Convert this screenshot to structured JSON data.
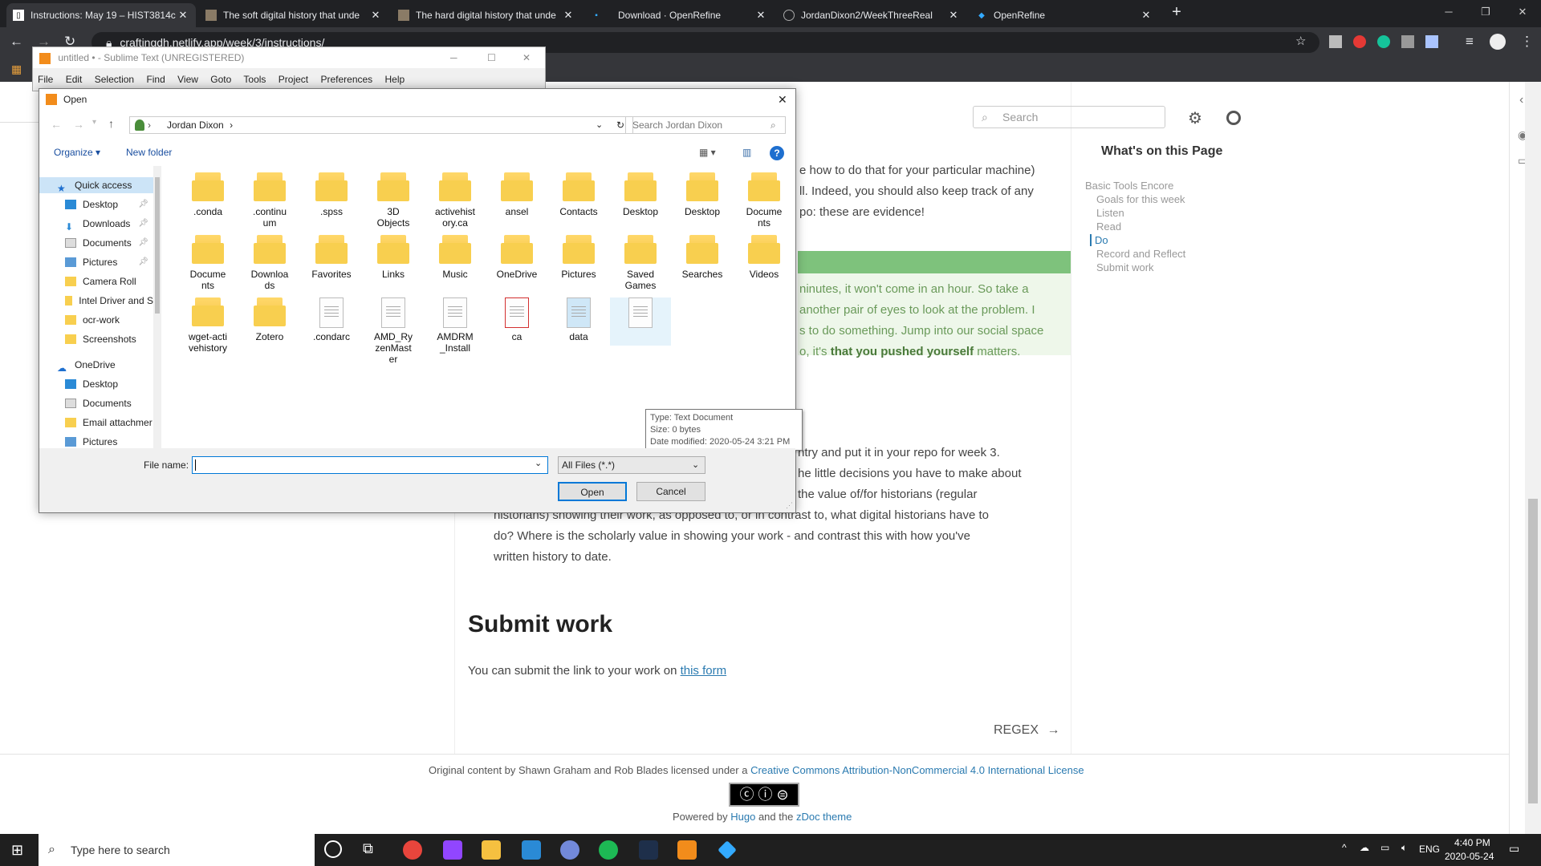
{
  "browser": {
    "tabs": [
      {
        "title": "Instructions: May 19 – HIST3814c"
      },
      {
        "title": "The soft digital history that unde"
      },
      {
        "title": "The hard digital history that unde"
      },
      {
        "title": "Download · OpenRefine"
      },
      {
        "title": "JordanDixon2/WeekThreeReal"
      },
      {
        "title": "OpenRefine"
      }
    ],
    "url": "craftingdh.netlify.app/week/3/instructions/"
  },
  "page": {
    "search_placeholder": "Search",
    "toc_title": "What's on this Page",
    "toc": [
      "Basic Tools Encore",
      "Goals for this week",
      "Listen",
      "Read",
      "Do",
      "Record and Reflect",
      "Submit work"
    ],
    "text_lines": [
      "e how to do that for your particular machine)",
      "ll. Indeed, you should also keep track of any",
      "po: these are evidence!"
    ],
    "notice_lines": [
      "ninutes, it won't come in an hour. So take a",
      "another pair of eyes to look at the problem. I",
      "s to do something. Jump into our social space"
    ],
    "notice_last_prefix": "o, it's ",
    "notice_last_bold": "that you pushed yourself",
    "notice_last_suffix": " matters.",
    "lines2": [
      "ntry and put it in your repo for week 3.",
      "he little decisions you have to make about",
      "the value of/for historians (regular"
    ],
    "lines3": [
      "historians) showing their work, as opposed to, or in contrast to, what digital historians have to",
      "do? Where is the scholarly value in showing your work - and contrast this with how you've",
      "written history to date."
    ],
    "submit_heading": "Submit work",
    "submit_prefix": "You can submit the link to your work on ",
    "submit_link": "this form",
    "next_link": "REGEX",
    "footer_prefix": "Original content by Shawn Graham and Rob Blades licensed under a ",
    "footer_link": "Creative Commons Attribution-NonCommercial 4.0 International License",
    "footer_powered": "Powered by ",
    "footer_hugo": "Hugo",
    "footer_and": " and the ",
    "footer_theme": "zDoc theme"
  },
  "sublime": {
    "title": "untitled • - Sublime Text (UNREGISTERED)",
    "menu": [
      "File",
      "Edit",
      "Selection",
      "Find",
      "View",
      "Goto",
      "Tools",
      "Project",
      "Preferences",
      "Help"
    ]
  },
  "dialog": {
    "title": "Open",
    "path": "Jordan Dixon",
    "search_placeholder": "Search Jordan Dixon",
    "organize": "Organize ▾",
    "new_folder": "New folder",
    "nav": [
      {
        "label": "Quick access",
        "pinned": false
      },
      {
        "label": "Desktop",
        "pinned": true
      },
      {
        "label": "Downloads",
        "pinned": true
      },
      {
        "label": "Documents",
        "pinned": true
      },
      {
        "label": "Pictures",
        "pinned": true
      },
      {
        "label": "Camera Roll",
        "pinned": false
      },
      {
        "label": "Intel Driver and S",
        "pinned": false
      },
      {
        "label": "ocr-work",
        "pinned": false
      },
      {
        "label": "Screenshots",
        "pinned": false
      },
      {
        "label": "OneDrive",
        "pinned": false
      },
      {
        "label": "Desktop",
        "pinned": false
      },
      {
        "label": "Documents",
        "pinned": false
      },
      {
        "label": "Email attachmer",
        "pinned": false
      },
      {
        "label": "Pictures",
        "pinned": false
      }
    ],
    "files": [
      ".conda",
      ".continuum",
      ".spss",
      "3D Objects",
      "activehistory.ca",
      "ansel",
      "Contacts",
      "Desktop",
      "Desktop",
      "Documents",
      "Documents",
      "Downloads",
      "Favorites",
      "Links",
      "Music",
      "OneDrive",
      "Pictures",
      "Saved Games",
      "Searches",
      "Videos",
      "wget-activehistory",
      "Zotero",
      ".condarc",
      "AMD_RyzenMaster",
      "AMDRM_Install",
      "ca",
      "data",
      ""
    ],
    "tooltip": [
      "Type: Text Document",
      "Size: 0 bytes",
      "Date modified: 2020-05-24 3:21 PM"
    ],
    "filename_label": "File name:",
    "filename_value": "",
    "filter": "All Files (*.*)",
    "open": "Open",
    "cancel": "Cancel"
  },
  "taskbar": {
    "search_placeholder": "Type here to search",
    "lang": "ENG",
    "time": "4:40 PM",
    "date": "2020-05-24"
  }
}
